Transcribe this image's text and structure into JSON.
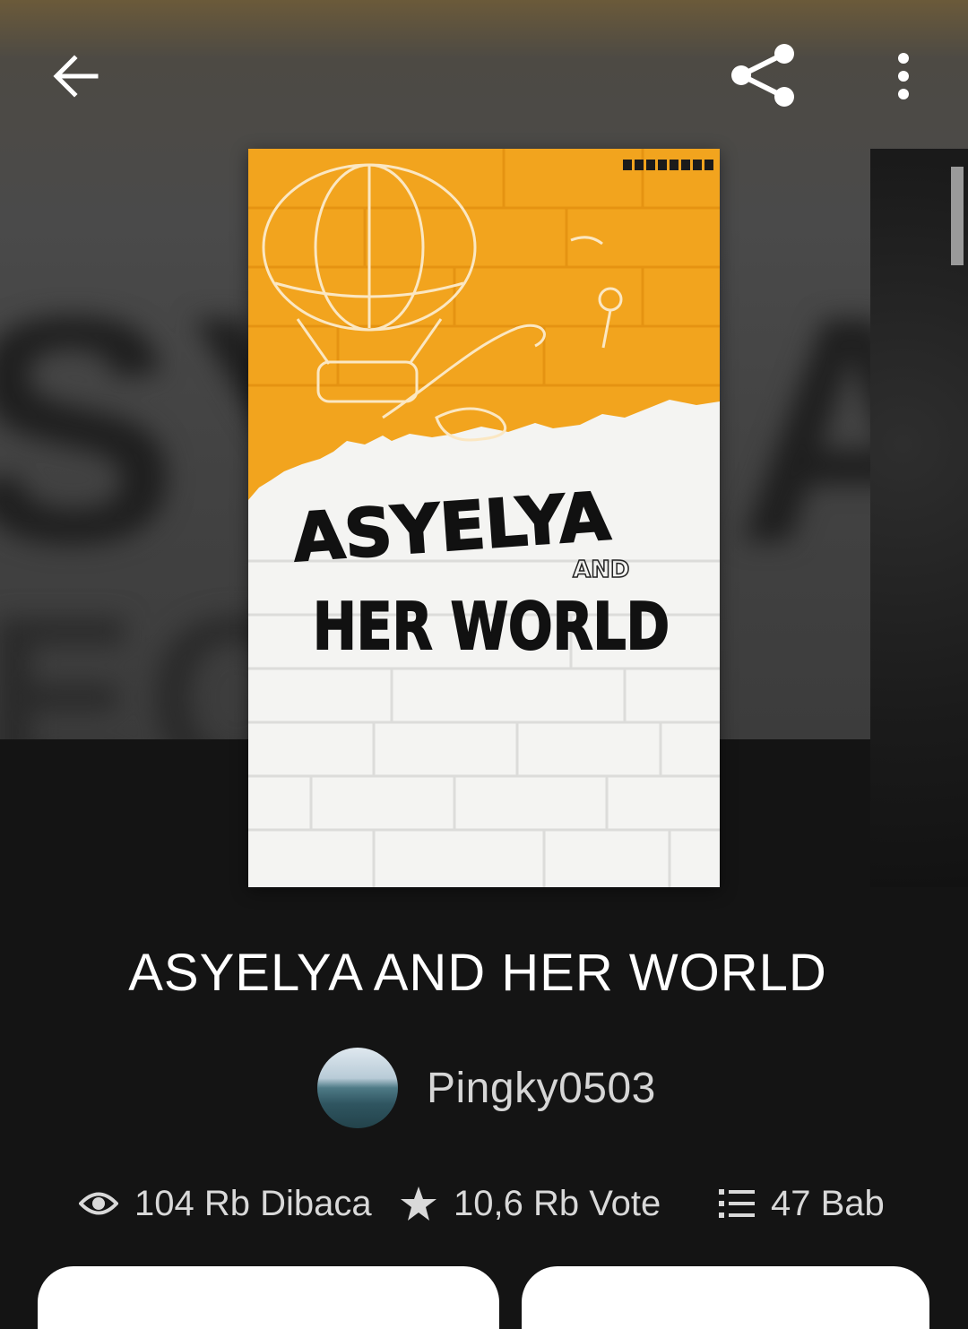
{
  "header": {
    "back_icon": "arrow-left-icon",
    "share_icon": "share-icon",
    "more_icon": "more-vertical-icon"
  },
  "book": {
    "cover_title_line1": "ASYELYA",
    "cover_title_and": "AND",
    "cover_title_line2": "HER WORLD",
    "title": "ASYELYA AND HER WORLD",
    "author": "Pingky0503"
  },
  "stats": {
    "reads": "104 Rb Dibaca",
    "votes": "10,6 Rb Vote",
    "chapters": "47 Bab"
  },
  "colors": {
    "background": "#141414",
    "cover_orange": "#f2a41e",
    "cover_white": "#f4f4f2"
  }
}
